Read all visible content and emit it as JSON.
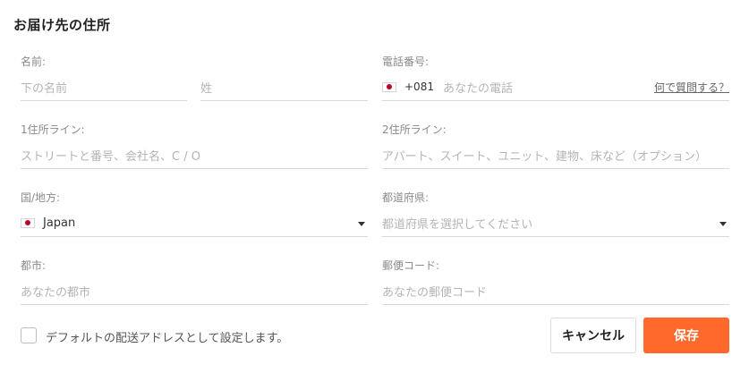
{
  "title": "お届け先の住所",
  "name": {
    "label": "名前:",
    "first_placeholder": "下の名前",
    "last_placeholder": "姓"
  },
  "phone": {
    "label": "電話番号:",
    "country_code": "+081",
    "placeholder": "あなたの電話",
    "help_link": "何で質問する？",
    "flag_icon": "japan-flag-icon"
  },
  "address1": {
    "label": "1住所ライン:",
    "placeholder": "ストリートと番号、会社名、C / O"
  },
  "address2": {
    "label": "2住所ライン:",
    "placeholder": "アパート、スイート、ユニット、建物、床など（オプション）"
  },
  "country": {
    "label": "国/地方:",
    "value": "Japan",
    "flag_icon": "japan-flag-icon",
    "dropdown_icon": "caret-down-icon"
  },
  "prefecture": {
    "label": "都道府県:",
    "placeholder": "都道府県を選択してください",
    "dropdown_icon": "caret-down-icon"
  },
  "city": {
    "label": "都市:",
    "placeholder": "あなたの都市"
  },
  "postal": {
    "label": "郵便コード:",
    "placeholder": "あなたの郵便コード"
  },
  "default_checkbox": {
    "label": "デフォルトの配送アドレスとして設定します。",
    "checked": false
  },
  "buttons": {
    "cancel": "キャンセル",
    "save": "保存"
  },
  "colors": {
    "accent": "#ff6a2c",
    "flag_red": "#bc002d",
    "placeholder": "#b4b4b4",
    "divider": "#d9d9d9"
  }
}
